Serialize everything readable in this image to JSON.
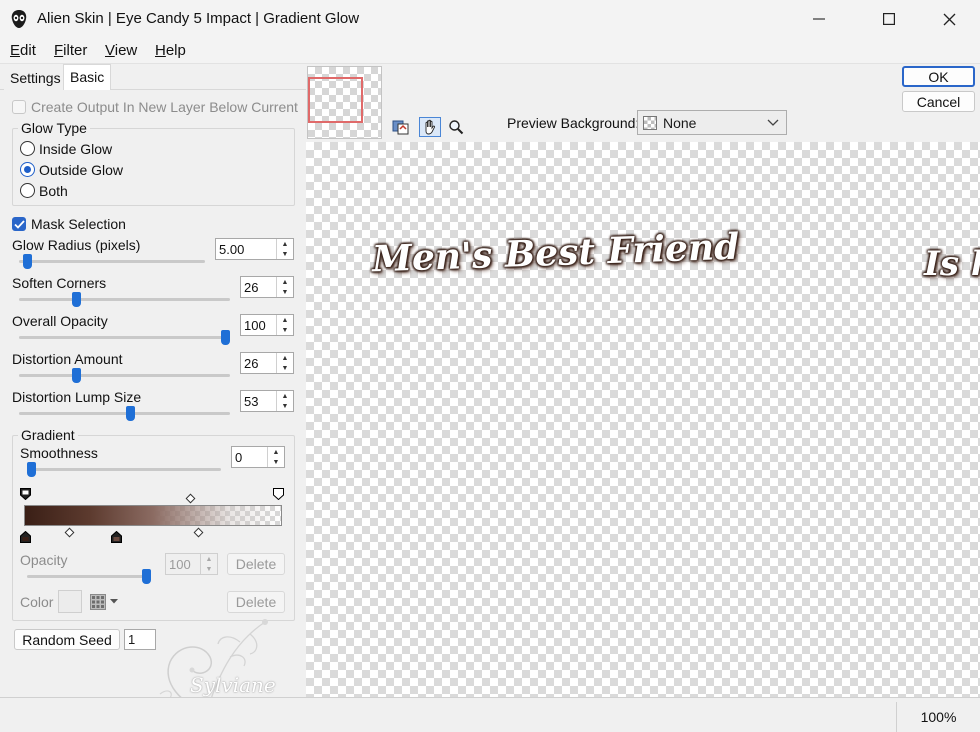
{
  "window": {
    "title": "Alien Skin | Eye Candy 5 Impact | Gradient Glow"
  },
  "menu": {
    "items": [
      {
        "label_first": "E",
        "label_rest": "dit"
      },
      {
        "label_first": "F",
        "label_rest": "ilter"
      },
      {
        "label_first": "V",
        "label_rest": "iew"
      },
      {
        "label_first": "H",
        "label_rest": "elp"
      }
    ]
  },
  "tabs": [
    "Settings",
    "Basic"
  ],
  "basic": {
    "create_output": "Create Output In New Layer Below Current",
    "glow_type": {
      "title": "Glow Type",
      "options": [
        "Inside Glow",
        "Outside Glow",
        "Both"
      ],
      "selected": "Outside Glow"
    },
    "mask_selection": "Mask Selection",
    "glow_radius": {
      "label": "Glow Radius (pixels)",
      "value": "5.00",
      "level": 0.02
    },
    "soften_corners": {
      "label": "Soften Corners",
      "value": "26",
      "level": 0.26
    },
    "overall_opacity": {
      "label": "Overall Opacity",
      "value": "100",
      "level": 1.0
    },
    "distortion_amount": {
      "label": "Distortion Amount",
      "value": "26",
      "level": 0.26
    },
    "distortion_lump": {
      "label": "Distortion Lump Size",
      "value": "53",
      "level": 0.53
    },
    "gradient": {
      "title": "Gradient",
      "smoothness_label": "Smoothness",
      "smoothness_value": "0",
      "smoothness_level": 0.0,
      "opacity_label": "Opacity",
      "opacity_value": "100",
      "opacity_level": 1.0,
      "color_label": "Color",
      "delete_label": "Delete",
      "start_color": "#3a1f16"
    },
    "random_seed_label": "Random Seed",
    "random_seed_value": "1"
  },
  "buttons": {
    "ok": "OK",
    "cancel": "Cancel"
  },
  "preview": {
    "background_label": "Preview Background:",
    "background_value": "None",
    "text_main": "Men's Best Friend",
    "text_cut": "Is h",
    "glow_color": "#3a241c"
  },
  "status": {
    "zoom": "100%"
  },
  "watermark": {
    "text": "Sylviane"
  }
}
